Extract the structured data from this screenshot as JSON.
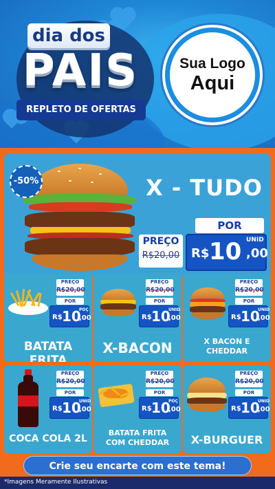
{
  "header": {
    "title_line1": "dia dos",
    "title_line2": "PAIS",
    "subtitle": "REPLETO DE OFERTAS",
    "logo_line1": "Sua Logo",
    "logo_line2": "Aqui"
  },
  "featured": {
    "badge": "-50%",
    "name": "X - TUDO",
    "por_label": "POR",
    "preco_label": "PREÇO",
    "old_price": "R$20,00",
    "currency": "R$",
    "price_int": "10",
    "price_dec": ",00",
    "unit": "UNID"
  },
  "products": [
    {
      "name": "BATATA FRITA",
      "preco_label": "PREÇO",
      "old_price": "R$20,00",
      "por_label": "POR",
      "currency": "R$",
      "price_int": "10",
      "price_dec": ",00",
      "unit": "POÇ"
    },
    {
      "name": "X-BACON",
      "preco_label": "PREÇO",
      "old_price": "R$20,00",
      "por_label": "POR",
      "currency": "R$",
      "price_int": "10",
      "price_dec": ",00",
      "unit": "UNID"
    },
    {
      "name": "X BACON E CHEDDAR",
      "preco_label": "PREÇO",
      "old_price": "R$20,00",
      "por_label": "POR",
      "currency": "R$",
      "price_int": "10",
      "price_dec": ",00",
      "unit": "UNID"
    },
    {
      "name": "COCA COLA 2L",
      "preco_label": "PREÇO",
      "old_price": "R$20,00",
      "por_label": "POR",
      "currency": "R$",
      "price_int": "10",
      "price_dec": ",00",
      "unit": "UNID"
    },
    {
      "name": "BATATA FRITA COM CHEDDAR",
      "preco_label": "PREÇO",
      "old_price": "R$20,00",
      "por_label": "POR",
      "currency": "R$",
      "price_int": "10",
      "price_dec": ",00",
      "unit": "POÇ"
    },
    {
      "name": "X-BURGUER",
      "preco_label": "PREÇO",
      "old_price": "R$20,00",
      "por_label": "POR",
      "currency": "R$",
      "price_int": "10",
      "price_dec": ",00",
      "unit": "UNID"
    }
  ],
  "cta": "Crie seu encarte com este tema!",
  "footer_note": "*Imagens Meramente Ilustrativas",
  "colors": {
    "header_blue": "#1f86d6",
    "panel_orange": "#f26a1b",
    "card_blue": "#3aa7cf",
    "price_blue": "#1654c4",
    "footer_navy": "#1a2a6b"
  },
  "icons": [
    "heart-icon",
    "burger-image",
    "fries-image",
    "soda-bottle-image"
  ]
}
